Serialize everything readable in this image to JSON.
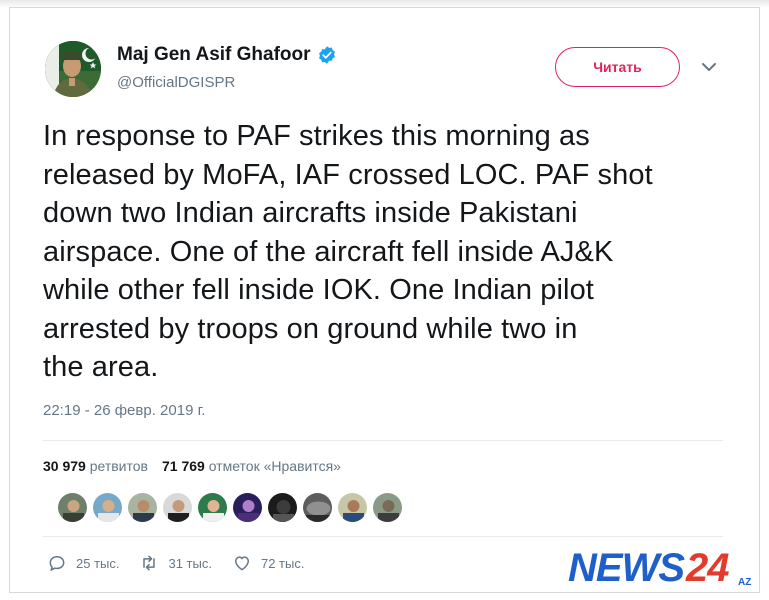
{
  "author": {
    "name": "Maj Gen Asif Ghafoor",
    "handle": "@OfficialDGISPR",
    "verified": true
  },
  "follow_button": {
    "label": "Читать"
  },
  "tweet": {
    "lines": [
      "In response to PAF strikes this morning as",
      "released by MoFA, IAF crossed LOC. PAF shot",
      "down two Indian aircrafts inside Pakistani",
      "airspace. One of the aircraft fell inside AJ&K",
      "while other fell inside IOK. One Indian pilot",
      "arrested by troops on ground while two in",
      "the area."
    ],
    "timestamp": "22:19 - 26 февр. 2019 г."
  },
  "stats": {
    "retweets_count": "30 979",
    "retweets_label": "ретвитов",
    "likes_count": "71 769",
    "likes_label": "отметок «Нравится»"
  },
  "actions": {
    "replies": "25 тыс.",
    "retweets": "31 тыс.",
    "likes": "72 тыс."
  },
  "watermark": {
    "text": "NEWS24",
    "sub": "AZ"
  },
  "colors": {
    "accent_pink": "#e0245e",
    "verified_blue": "#1da1f2",
    "muted_text": "#657786",
    "watermark_blue": "#1f5fc9"
  },
  "icons": [
    "verified-badge-icon",
    "chevron-down-icon",
    "reply-icon",
    "retweet-icon",
    "heart-icon"
  ]
}
